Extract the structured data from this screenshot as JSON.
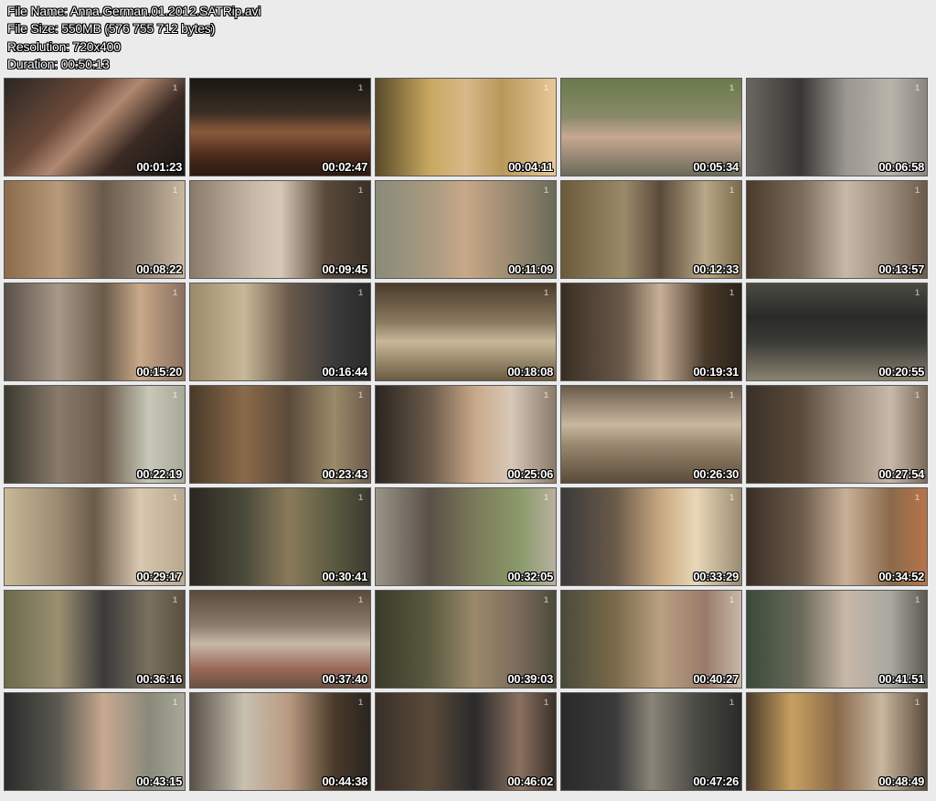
{
  "header": {
    "file_name": "File Name: Anna.German.01.2012.SATRip.avi",
    "file_size": "File Size: 550MB (576 755 712 bytes)",
    "resolution": "Resolution: 720x400",
    "duration": "Duration: 00:50:13"
  },
  "logo_glyph": "1",
  "thumbnails": [
    {
      "time": "00:01:23",
      "bg": "linear-gradient(135deg,#2a2622 0%,#6b4a3a 35%,#b08870 50%,#3a2a22 70%,#1a1614 100%)"
    },
    {
      "time": "00:02:47",
      "bg": "linear-gradient(180deg,#1a1612 0%,#3a2e24 35%,#8a5a3a 55%,#4a2a1a 80%,#2a1a12 100%)"
    },
    {
      "time": "00:04:11",
      "bg": "linear-gradient(90deg,#5a4a2a 0%,#c8a860 30%,#d8b888 50%,#b8985a 70%,#e8c898 100%)"
    },
    {
      "time": "00:05:34",
      "bg": "linear-gradient(180deg,#6a7a4a 0%,#8a8a6a 40%,#c8a890 60%,#6a6a5a 100%)"
    },
    {
      "time": "00:06:58",
      "bg": "linear-gradient(90deg,#6a6660 0%,#3a3634 30%,#9a9690 55%,#b8b4aa 80%,#8a8680 100%)"
    },
    {
      "time": "00:08:22",
      "bg": "linear-gradient(90deg,#8a6a4a 0%,#b89a7a 30%,#6a5a4a 55%,#9a8a7a 80%,#c8b8a0 100%)"
    },
    {
      "time": "00:09:45",
      "bg": "linear-gradient(90deg,#8a7a6a 0%,#c8b8a8 35%,#d8c8b8 50%,#5a4a3a 75%,#3a3028 100%)"
    },
    {
      "time": "00:11:09",
      "bg": "linear-gradient(90deg,#8a8a7a 0%,#a89a80 30%,#c8a888 50%,#9a8a70 75%,#6a6a5a 100%)"
    },
    {
      "time": "00:12:33",
      "bg": "linear-gradient(90deg,#6a5a3a 0%,#9a8a6a 35%,#5a4a3a 55%,#b8a888 80%,#7a6a4a 100%)"
    },
    {
      "time": "00:13:57",
      "bg": "linear-gradient(90deg,#4a3a2a 0%,#7a6a5a 30%,#c8b8a8 55%,#9a8a7a 80%,#6a5a4a 100%)"
    },
    {
      "time": "00:15:20",
      "bg": "linear-gradient(90deg,#5a5048 0%,#a89888 30%,#6a5a4a 55%,#c8a888 75%,#8a7060 100%)"
    },
    {
      "time": "00:16:44",
      "bg": "linear-gradient(90deg,#9a8a6a 0%,#c8b898 30%,#6a5a4a 55%,#3a3a3a 80%,#2a2a2a 100%)"
    },
    {
      "time": "00:18:08",
      "bg": "linear-gradient(180deg,#4a3a2a 0%,#8a7a60 40%,#c8b898 60%,#6a5a40 100%)"
    },
    {
      "time": "00:19:31",
      "bg": "linear-gradient(90deg,#3a2e24 0%,#6a5a4a 35%,#c8b098 55%,#4a3a2a 80%,#2a221a 100%)"
    },
    {
      "time": "00:20:55",
      "bg": "linear-gradient(180deg,#4a4a40 0%,#2a2a2a 35%,#3a3a36 60%,#8a8270 100%)"
    },
    {
      "time": "00:22:19",
      "bg": "linear-gradient(90deg,#3a3a30 0%,#8a7a6a 30%,#6a5a4a 55%,#c8c8b8 80%,#a8a898 100%)"
    },
    {
      "time": "00:23:43",
      "bg": "linear-gradient(90deg,#4a3a2a 0%,#8a6a4a 30%,#5a4a3a 55%,#9a8a6a 80%,#6a5a4a 100%)"
    },
    {
      "time": "00:25:06",
      "bg": "linear-gradient(90deg,#2a2520 0%,#6a5a4a 30%,#c8a888 55%,#d8c8b8 75%,#8a7a6a 100%)"
    },
    {
      "time": "00:26:30",
      "bg": "linear-gradient(180deg,#6a5a4a 0%,#c8b8a0 40%,#9a8a70 60%,#5a4a3a 100%)"
    },
    {
      "time": "00:27:54",
      "bg": "linear-gradient(90deg,#3a3028 0%,#5a4a3a 30%,#9a8a7a 55%,#c8b8a8 80%,#7a6a5a 100%)"
    },
    {
      "time": "00:29:17",
      "bg": "linear-gradient(90deg,#c8b898 0%,#9a8a70 30%,#6a5a4a 50%,#d8c8b0 75%,#b8a890 100%)"
    },
    {
      "time": "00:30:41",
      "bg": "linear-gradient(90deg,#2a2620 0%,#4a4a3a 30%,#8a7a5a 55%,#5a5a40 80%,#3a3a30 100%)"
    },
    {
      "time": "00:32:05",
      "bg": "linear-gradient(90deg,#9a9488 0%,#5a5048 30%,#7a7a5a 55%,#8a9a6a 80%,#b8b0a0 100%)"
    },
    {
      "time": "00:33:29",
      "bg": "linear-gradient(90deg,#3a3a3a 0%,#6a5a4a 30%,#c8a880 55%,#e8d8b8 75%,#9a8a70 100%)"
    },
    {
      "time": "00:34:52",
      "bg": "linear-gradient(90deg,#3a2e24 0%,#6a5a4a 30%,#c8b098 55%,#8a6a4a 80%,#b8744a 100%)"
    },
    {
      "time": "00:36:16",
      "bg": "linear-gradient(90deg,#6a6a4a 0%,#9a9070 30%,#3a3a3a 55%,#7a7060 80%,#5a5040 100%)"
    },
    {
      "time": "00:37:40",
      "bg": "linear-gradient(180deg,#5a4a3a 0%,#8a7a6a 35%,#c8b8a8 55%,#9a6a5a 80%,#6a5040 100%)"
    },
    {
      "time": "00:39:03",
      "bg": "linear-gradient(90deg,#3a3a2a 0%,#5a5a40 30%,#9a8a6a 55%,#7a6a5a 80%,#4a4a3a 100%)"
    },
    {
      "time": "00:40:27",
      "bg": "linear-gradient(90deg,#4a4a3a 0%,#7a6a4a 30%,#b8a080 55%,#9a7a6a 80%,#c8b8a8 100%)"
    },
    {
      "time": "00:41:51",
      "bg": "linear-gradient(90deg,#3a4a3a 0%,#6a6a5a 30%,#c8b8a8 55%,#a8a8a0 80%,#5a5a50 100%)"
    },
    {
      "time": "00:43:15",
      "bg": "linear-gradient(90deg,#2a2a2a 0%,#5a5a50 30%,#c8a890 55%,#8a8a7a 80%,#a8a898 100%)"
    },
    {
      "time": "00:44:38",
      "bg": "linear-gradient(90deg,#5a5048 0%,#c8c0b0 30%,#b89a80 55%,#4a3a2a 80%,#2a2520 100%)"
    },
    {
      "time": "00:46:02",
      "bg": "linear-gradient(90deg,#3a3028 0%,#5a4a3a 30%,#2a2a2a 55%,#8a7060 80%,#3a3028 100%)"
    },
    {
      "time": "00:47:26",
      "bg": "linear-gradient(90deg,#2a2a2a 0%,#3a3a3a 30%,#8a8478 50%,#4a4a44 75%,#2a2a28 100%)"
    },
    {
      "time": "00:48:49",
      "bg": "linear-gradient(90deg,#4a3a2a 0%,#c8a060 25%,#8a6a4a 50%,#c8b8a0 75%,#5a4a3a 100%)"
    }
  ]
}
